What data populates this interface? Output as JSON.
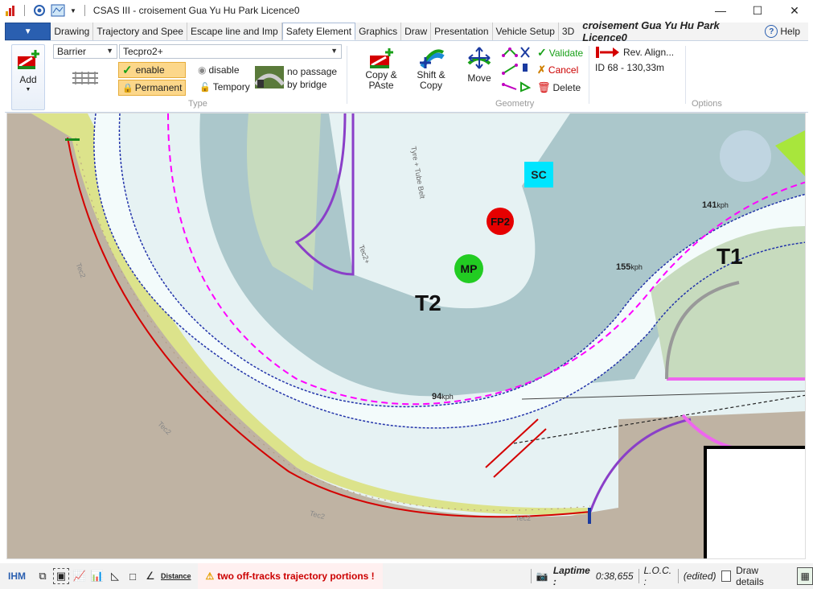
{
  "app": {
    "title": "CSAS III - croisement Gua Yu Hu Park Licence0",
    "document_title": "croisement Gua Yu Hu Park Licence0",
    "help_label": "Help"
  },
  "window_controls": {
    "minimize": "—",
    "maximize": "☐",
    "close": "✕"
  },
  "tabs": [
    {
      "label": "Drawing"
    },
    {
      "label": "Trajectory and Spee"
    },
    {
      "label": "Escape line and Imp"
    },
    {
      "label": "Safety Element"
    },
    {
      "label": "Graphics"
    },
    {
      "label": "Draw"
    },
    {
      "label": "Presentation"
    },
    {
      "label": "Vehicle Setup"
    },
    {
      "label": "3D"
    }
  ],
  "ribbon": {
    "add_label": "Add",
    "type_group": {
      "label": "Type",
      "element_type": "Barrier",
      "element_model": "Tecpro2+",
      "enable_label": "enable",
      "disable_label": "disable",
      "permanent_label": "Permanent",
      "tempory_label": "Tempory",
      "no_passage_line1": "no passage",
      "no_passage_line2": "by bridge"
    },
    "geometry_group": {
      "label": "Geometry",
      "copy_paste_line1": "Copy &",
      "copy_paste_line2": "PAste",
      "shift_copy_line1": "Shift &",
      "shift_copy_line2": "Copy",
      "move_label": "Move",
      "validate_label": "Validate",
      "cancel_label": "Cancel",
      "delete_label": "Delete",
      "rev_align_label": "Rev.  Align...",
      "id_info": "ID  68 - 130,33m"
    },
    "options_group": {
      "label": "Options"
    }
  },
  "map": {
    "turn_labels": [
      "T2",
      "T1"
    ],
    "markers": [
      {
        "label": "SC",
        "color": "#00e5ff"
      },
      {
        "label": "FP2",
        "color": "#e60000"
      },
      {
        "label": "MP",
        "color": "#22cc22"
      }
    ],
    "speeds": [
      {
        "value": "141",
        "unit": "kph"
      },
      {
        "value": "155",
        "unit": "kph"
      },
      {
        "value": "94",
        "unit": "kph"
      }
    ],
    "barrier_tags": [
      "Tec2+",
      "Tec2",
      "Tec2",
      "Tec2",
      "Tec2"
    ],
    "tyre_label": "Tyre + Tube Belt"
  },
  "status": {
    "ihm": "IHM",
    "distance_label": "Distance",
    "warning": "two off-tracks trajectory portions !",
    "laptime_label": "Laptime :",
    "laptime_value": "0:38,655",
    "loc_label": "L.O.C. :",
    "edited": "(edited)",
    "draw_details": "Draw details"
  },
  "colors": {
    "accent": "#2a5fb0",
    "trajectory": "#ff00ff",
    "barrier_red": "#d40000",
    "safety_purple": "#8a3fc8",
    "warning_red": "#cc0000"
  }
}
